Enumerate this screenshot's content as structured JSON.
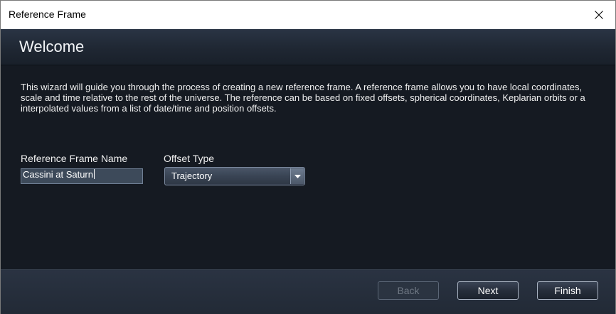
{
  "window": {
    "title": "Reference Frame",
    "close_icon": "close-icon"
  },
  "header": {
    "title": "Welcome"
  },
  "main": {
    "description": "This wizard will guide you through the process of creating a new reference frame. A reference frame allows you to have local coordinates, scale and time relative to the rest of the universe. The reference can be based on fixed offsets, spherical coordinates, Keplarian orbits or a interpolated values from a list of date/time and position offsets.",
    "name_field": {
      "label": "Reference Frame Name",
      "value": "Cassini at Saturn"
    },
    "offset_type": {
      "label": "Offset Type",
      "selected": "Trajectory",
      "arrow_icon": "chevron-down-icon"
    }
  },
  "footer": {
    "back_label": "Back",
    "next_label": "Next",
    "finish_label": "Finish"
  },
  "colors": {
    "background": "#151a22",
    "header": "#222b38",
    "input": "#3d4a5a",
    "text": "#f0f0f0"
  }
}
